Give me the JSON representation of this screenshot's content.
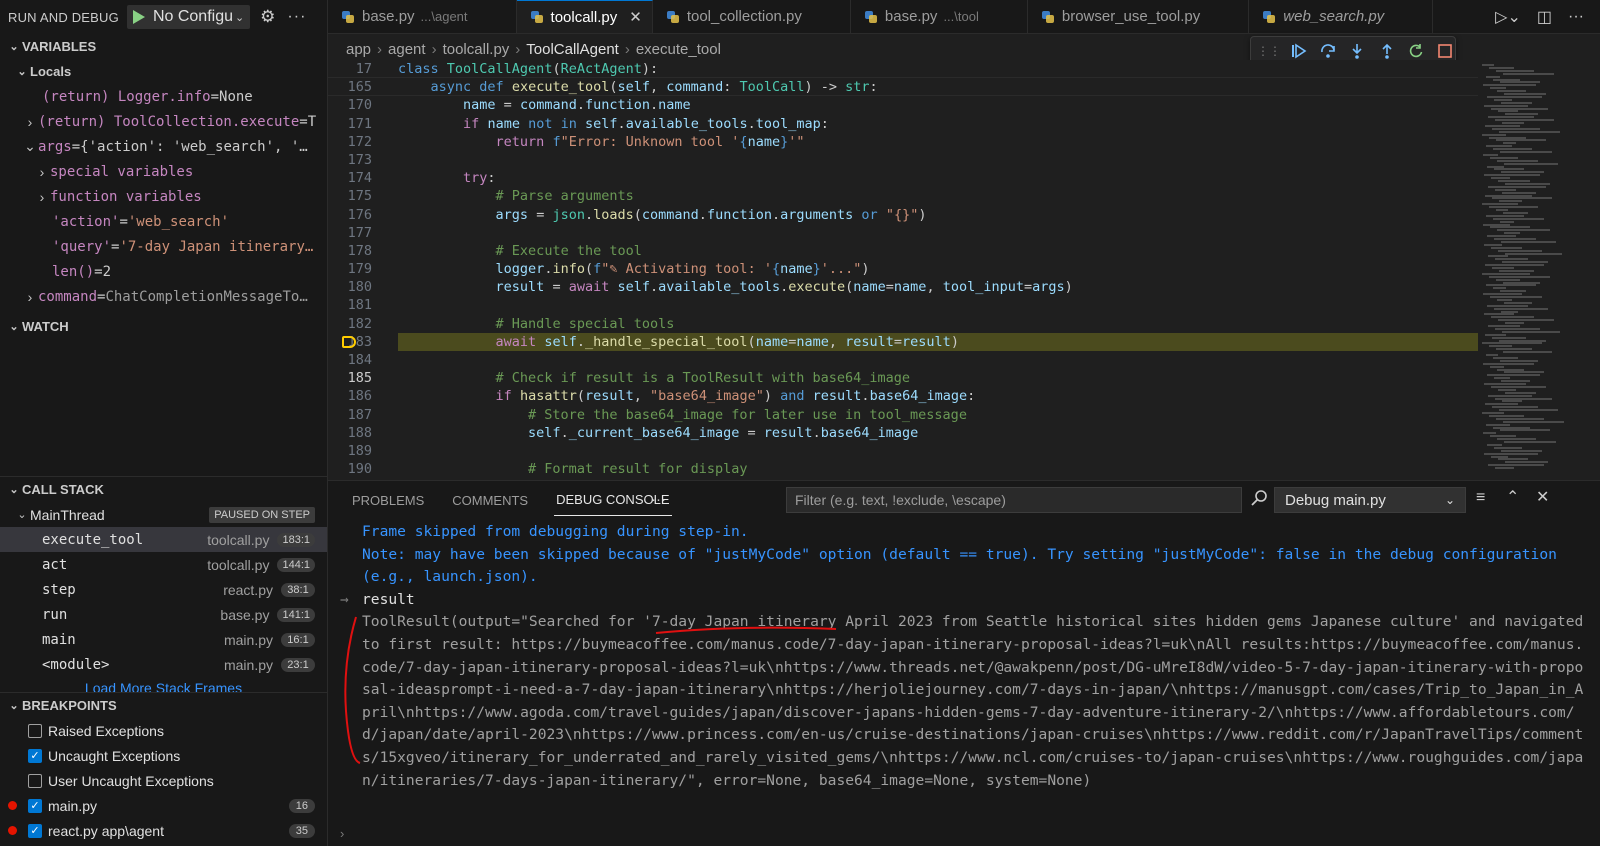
{
  "sidebar": {
    "title": "RUN AND DEBUG",
    "config": "No Configu",
    "variables_header": "VARIABLES",
    "locals_header": "Locals",
    "variables": [
      {
        "indent": 42,
        "chevron": "",
        "name": "(return) Logger.info",
        "eq": " = ",
        "value": "None",
        "vclass": "v-plain"
      },
      {
        "indent": 22,
        "chevron": ">",
        "name": "(return) ToolCollection.execute",
        "eq": " = ",
        "value": "T",
        "vclass": "v-plain"
      },
      {
        "indent": 22,
        "chevron": "v",
        "name": "args",
        "eq": " = ",
        "value": "{'action': 'web_search', '…",
        "vclass": "v-plain"
      },
      {
        "indent": 34,
        "chevron": ">",
        "name": "special variables",
        "eq": "",
        "value": "",
        "vclass": "v-plain"
      },
      {
        "indent": 34,
        "chevron": ">",
        "name": "function variables",
        "eq": "",
        "value": "",
        "vclass": "v-plain"
      },
      {
        "indent": 52,
        "chevron": "",
        "name": "'action'",
        "eq": " = ",
        "value": "'web_search'",
        "vclass": "v-str"
      },
      {
        "indent": 52,
        "chevron": "",
        "name": "'query'",
        "eq": " = ",
        "value": "'7-day Japan itinerary…",
        "vclass": "v-str"
      },
      {
        "indent": 52,
        "chevron": "",
        "name": "len()",
        "eq": " = ",
        "value": "2",
        "vclass": "v-plain"
      },
      {
        "indent": 22,
        "chevron": ">",
        "name": "command",
        "eq": " = ",
        "value": "ChatCompletionMessageTo…",
        "vclass": "v-dim"
      }
    ],
    "watch_header": "WATCH",
    "callstack_header": "CALL STACK",
    "thread": "MainThread",
    "paused": "PAUSED ON STEP",
    "frames": [
      {
        "fn": "execute_tool",
        "file": "toolcall.py",
        "pos": "183:1"
      },
      {
        "fn": "act",
        "file": "toolcall.py",
        "pos": "144:1"
      },
      {
        "fn": "step",
        "file": "react.py",
        "pos": "38:1"
      },
      {
        "fn": "run",
        "file": "base.py",
        "pos": "141:1"
      },
      {
        "fn": "main",
        "file": "main.py",
        "pos": "16:1"
      },
      {
        "fn": "<module>",
        "file": "main.py",
        "pos": "23:1"
      }
    ],
    "load_more": "Load More Stack Frames",
    "breakpoints_header": "BREAKPOINTS",
    "breakpoints": [
      {
        "label": "Raised Exceptions",
        "checked": false,
        "count": ""
      },
      {
        "label": "Uncaught Exceptions",
        "checked": true,
        "count": ""
      },
      {
        "label": "User Uncaught Exceptions",
        "checked": false,
        "count": ""
      },
      {
        "label": "main.py",
        "checked": true,
        "count": "16"
      },
      {
        "label": "react.py   app\\agent",
        "checked": true,
        "count": "35"
      }
    ]
  },
  "tabs": [
    {
      "label": "base.py",
      "path": "...\\agent",
      "active": false,
      "italic": false
    },
    {
      "label": "toolcall.py",
      "path": "",
      "active": true,
      "italic": false
    },
    {
      "label": "tool_collection.py",
      "path": "",
      "active": false,
      "italic": false
    },
    {
      "label": "base.py",
      "path": "...\\tool",
      "active": false,
      "italic": false
    },
    {
      "label": "browser_use_tool.py",
      "path": "",
      "active": false,
      "italic": false
    },
    {
      "label": "web_search.py",
      "path": "",
      "active": false,
      "italic": true
    }
  ],
  "breadcrumb": [
    "app",
    "agent",
    "toolcall.py",
    "ToolCallAgent",
    "execute_tool"
  ],
  "code": [
    {
      "n": "17",
      "sticky": true,
      "html": "<span class='ck'>class</span> <span class='ct'>ToolCallAgent</span>(<span class='ct'>ReActAgent</span>):"
    },
    {
      "n": "165",
      "sticky": true,
      "html": "    <span class='ck'>async</span> <span class='ck'>def</span> <span class='cf'>execute_tool</span>(<span class='cv'>self</span>, <span class='cv'>command</span>: <span class='ct'>ToolCall</span>) -> <span class='ct'>str</span>:"
    },
    {
      "n": "170",
      "html": "        <span class='cv'>name</span> = <span class='cv'>command</span>.<span class='cv'>function</span>.<span class='cv'>name</span>"
    },
    {
      "n": "171",
      "html": "        <span class='cc'>if</span> <span class='cv'>name</span> <span class='ck'>not</span> <span class='ck'>in</span> <span class='cv'>self</span>.<span class='cv'>available_tools</span>.<span class='cv'>tool_map</span>:"
    },
    {
      "n": "172",
      "html": "            <span class='cc'>return</span> <span class='ck'>f</span><span class='cs'>\"Error: Unknown tool '</span><span class='ck'>{</span><span class='cv'>name</span><span class='ck'>}</span><span class='cs'>'\"</span>"
    },
    {
      "n": "173",
      "html": ""
    },
    {
      "n": "174",
      "html": "        <span class='cc'>try</span>:"
    },
    {
      "n": "175",
      "html": "            <span class='cm'># Parse arguments</span>"
    },
    {
      "n": "176",
      "html": "            <span class='cv'>args</span> = <span class='ct'>json</span>.<span class='cf'>loads</span>(<span class='cv'>command</span>.<span class='cv'>function</span>.<span class='cv'>arguments</span> <span class='ck'>or</span> <span class='cs'>\"{}\"</span>)"
    },
    {
      "n": "177",
      "html": ""
    },
    {
      "n": "178",
      "html": "            <span class='cm'># Execute the tool</span>"
    },
    {
      "n": "179",
      "html": "            <span class='cv'>logger</span>.<span class='cf'>info</span>(<span class='ck'>f</span><span class='cs'>\"✎ Activating tool: '</span><span class='ck'>{</span><span class='cv'>name</span><span class='ck'>}</span><span class='cs'>'...\"</span>)"
    },
    {
      "n": "180",
      "html": "            <span class='cv'>result</span> = <span class='cc'>await</span> <span class='cv'>self</span>.<span class='cv'>available_tools</span>.<span class='cf'>execute</span>(<span class='cv'>name</span>=<span class='cv'>name</span>, <span class='cv'>tool_input</span>=<span class='cv'>args</span>)"
    },
    {
      "n": "181",
      "html": ""
    },
    {
      "n": "182",
      "html": "            <span class='cm'># Handle special tools</span>"
    },
    {
      "n": "183",
      "hl": true,
      "html": "            <span class='cc'>await</span> <span class='cv'>self</span>.<span class='cf'>_handle_special_tool</span>(<span class='cv'>name</span>=<span class='cv'>name</span>, <span class='cv'>result</span>=<span class='cv'>result</span>)"
    },
    {
      "n": "184",
      "html": ""
    },
    {
      "n": "185",
      "cur": true,
      "html": "            <span class='cm'># Check if result is a ToolResult with base64_image</span>"
    },
    {
      "n": "186",
      "html": "            <span class='cc'>if</span> <span class='cf'>hasattr</span>(<span class='cv'>result</span>, <span class='cs'>\"base64_image\"</span>) <span class='ck'>and</span> <span class='cv'>result</span>.<span class='cv'>base64_image</span>:"
    },
    {
      "n": "187",
      "html": "                <span class='cm'># Store the base64_image for later use in tool_message</span>"
    },
    {
      "n": "188",
      "html": "                <span class='cv'>self</span>.<span class='cv'>_current_base64_image</span> = <span class='cv'>result</span>.<span class='cv'>base64_image</span>"
    },
    {
      "n": "189",
      "html": ""
    },
    {
      "n": "190",
      "html": "                <span class='cm'># Format result for display</span>"
    }
  ],
  "panel": {
    "tabs": [
      "PROBLEMS",
      "COMMENTS",
      "DEBUG CONSOLE"
    ],
    "filter_placeholder": "Filter (e.g. text, !exclude, \\escape)",
    "session": "Debug main.py",
    "console": [
      {
        "kind": "info",
        "text": "Frame skipped from debugging during step-in."
      },
      {
        "kind": "info",
        "text": "Note: may have been skipped because of \"justMyCode\" option (default == true). Try setting \"justMyCode\": false in the debug configuration (e.g., launch.json)."
      },
      {
        "kind": "input",
        "text": "result"
      },
      {
        "kind": "out",
        "text": "ToolResult(output=\"Searched for '7-day Japan itinerary April 2023 from Seattle historical sites hidden gems Japanese culture' and navigated to first result: https://buymeacoffee.com/manus.code/7-day-japan-itinerary-proposal-ideas?l=uk\\nAll results:https://buymeacoffee.com/manus.code/7-day-japan-itinerary-proposal-ideas?l=uk\\nhttps://www.threads.net/@awakpenn/post/DG-uMreI8dW/video-5-7-day-japan-itinerary-with-proposal-ideasprompt-i-need-a-7-day-japan-itinerary\\nhttps://herjoliejourney.com/7-days-in-japan/\\nhttps://manusgpt.com/cases/Trip_to_Japan_in_April\\nhttps://www.agoda.com/travel-guides/japan/discover-japans-hidden-gems-7-day-adventure-itinerary-2/\\nhttps://www.affordabletours.com/d/japan/date/april-2023\\nhttps://www.princess.com/en-us/cruise-destinations/japan-cruises\\nhttps://www.reddit.com/r/JapanTravelTips/comments/15xgveo/itinerary_for_underrated_and_rarely_visited_gems/\\nhttps://www.ncl.com/cruises-to/japan-cruises\\nhttps://www.roughguides.com/japan/itineraries/7-days-japan-itinerary/\", error=None, base64_image=None, system=None)"
      }
    ]
  },
  "colors": {
    "accent": "#0078d4",
    "breakpoint": "#e51400",
    "current_line": "#4b4b1e",
    "annotation": "#e01010"
  }
}
